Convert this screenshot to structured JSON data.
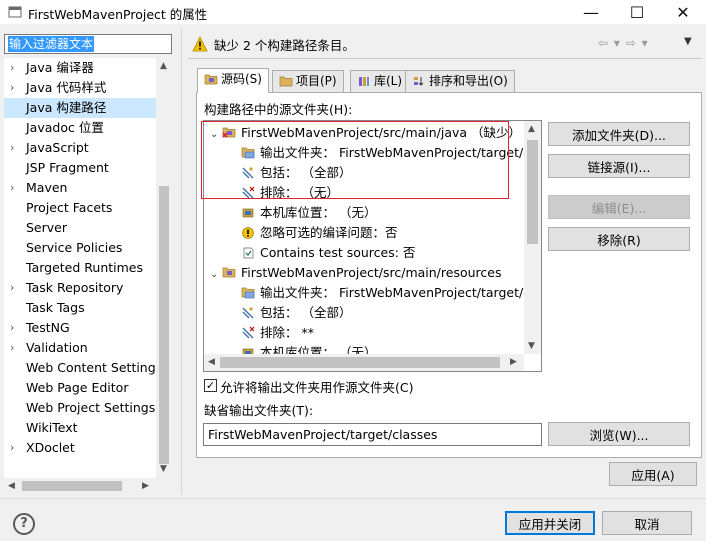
{
  "window": {
    "title": "FirstWebMavenProject 的属性",
    "minimize_glyph": "—",
    "maximize_glyph": "☐",
    "close_glyph": "✕"
  },
  "filter": {
    "value": "输入过滤器文本"
  },
  "nav": {
    "items": [
      {
        "label": "Java 编译器",
        "expandable": true
      },
      {
        "label": "Java 代码样式",
        "expandable": true
      },
      {
        "label": "Java 构建路径",
        "expandable": false,
        "selected": true
      },
      {
        "label": "Javadoc 位置",
        "expandable": false
      },
      {
        "label": "JavaScript",
        "expandable": true
      },
      {
        "label": "JSP Fragment",
        "expandable": false
      },
      {
        "label": "Maven",
        "expandable": true
      },
      {
        "label": "Project Facets",
        "expandable": false
      },
      {
        "label": "Server",
        "expandable": false
      },
      {
        "label": "Service Policies",
        "expandable": false
      },
      {
        "label": "Targeted Runtimes",
        "expandable": false
      },
      {
        "label": "Task Repository",
        "expandable": true
      },
      {
        "label": "Task Tags",
        "expandable": false
      },
      {
        "label": "TestNG",
        "expandable": true
      },
      {
        "label": "Validation",
        "expandable": true
      },
      {
        "label": "Web Content Settings",
        "expandable": false
      },
      {
        "label": "Web Page Editor",
        "expandable": false
      },
      {
        "label": "Web Project Settings",
        "expandable": false
      },
      {
        "label": "WikiText",
        "expandable": false
      },
      {
        "label": "XDoclet",
        "expandable": true
      }
    ],
    "expand_glyph": "›"
  },
  "header": {
    "message": "缺少 2 个构建路径条目。",
    "nav_glyphs": "⇦ ▾ ⇨ ▾",
    "menu_glyph": "▼"
  },
  "tabs": [
    {
      "label": "源码(S)",
      "active": true,
      "icon": "source-folder-icon"
    },
    {
      "label": "项目(P)",
      "active": false,
      "icon": "project-icon"
    },
    {
      "label": "库(L)",
      "active": false,
      "icon": "library-icon"
    },
    {
      "label": "排序和导出(O)",
      "active": false,
      "icon": "order-export-icon"
    }
  ],
  "source": {
    "label": "构建路径中的源文件夹(H):",
    "tree": [
      {
        "level": 0,
        "text": "FirstWebMavenProject/src/main/java （缺少）",
        "icon": "missing-source-folder-icon",
        "chevron": "⌄"
      },
      {
        "level": 1,
        "text": "输出文件夹： FirstWebMavenProject/target/classes",
        "icon": "output-folder-icon"
      },
      {
        "level": 1,
        "text": "包括： （全部）",
        "icon": "inclusion-filter-icon"
      },
      {
        "level": 1,
        "text": "排除： （无）",
        "icon": "exclusion-filter-icon"
      },
      {
        "level": 1,
        "text": "本机库位置： （无）",
        "icon": "native-library-icon"
      },
      {
        "level": 1,
        "text": "忽略可选的编译问题：否",
        "icon": "ignore-problems-icon"
      },
      {
        "level": 1,
        "text": "Contains test sources: 否",
        "icon": "test-sources-icon"
      },
      {
        "level": 0,
        "text": "FirstWebMavenProject/src/main/resources",
        "icon": "source-folder-icon",
        "chevron": "⌄"
      },
      {
        "level": 1,
        "text": "输出文件夹： FirstWebMavenProject/target/classes",
        "icon": "output-folder-icon"
      },
      {
        "level": 1,
        "text": "包括： （全部）",
        "icon": "inclusion-filter-icon"
      },
      {
        "level": 1,
        "text": "排除： **",
        "icon": "exclusion-filter-icon"
      },
      {
        "level": 1,
        "text": "本机库位置： （无）",
        "icon": "native-library-icon"
      }
    ]
  },
  "side_buttons": {
    "add_folder": "添加文件夹(D)...",
    "link_source": "链接源(I)...",
    "edit": "编辑(E)...",
    "remove": "移除(R)"
  },
  "allow_output": {
    "label": "允许将输出文件夹用作源文件夹(C)",
    "checked": true,
    "check_glyph": "✓"
  },
  "output": {
    "label": "缺省输出文件夹(T):",
    "value": "FirstWebMavenProject/target/classes",
    "browse": "浏览(W)..."
  },
  "footer": {
    "apply": "应用(A)",
    "apply_close": "应用并关闭",
    "cancel": "取消",
    "help_glyph": "?"
  },
  "colors": {
    "selection": "#cce8ff",
    "highlight_box": "#e8212e",
    "warning": "#f2c100",
    "folder": "#dcb35c",
    "accent": "#0078d7"
  }
}
